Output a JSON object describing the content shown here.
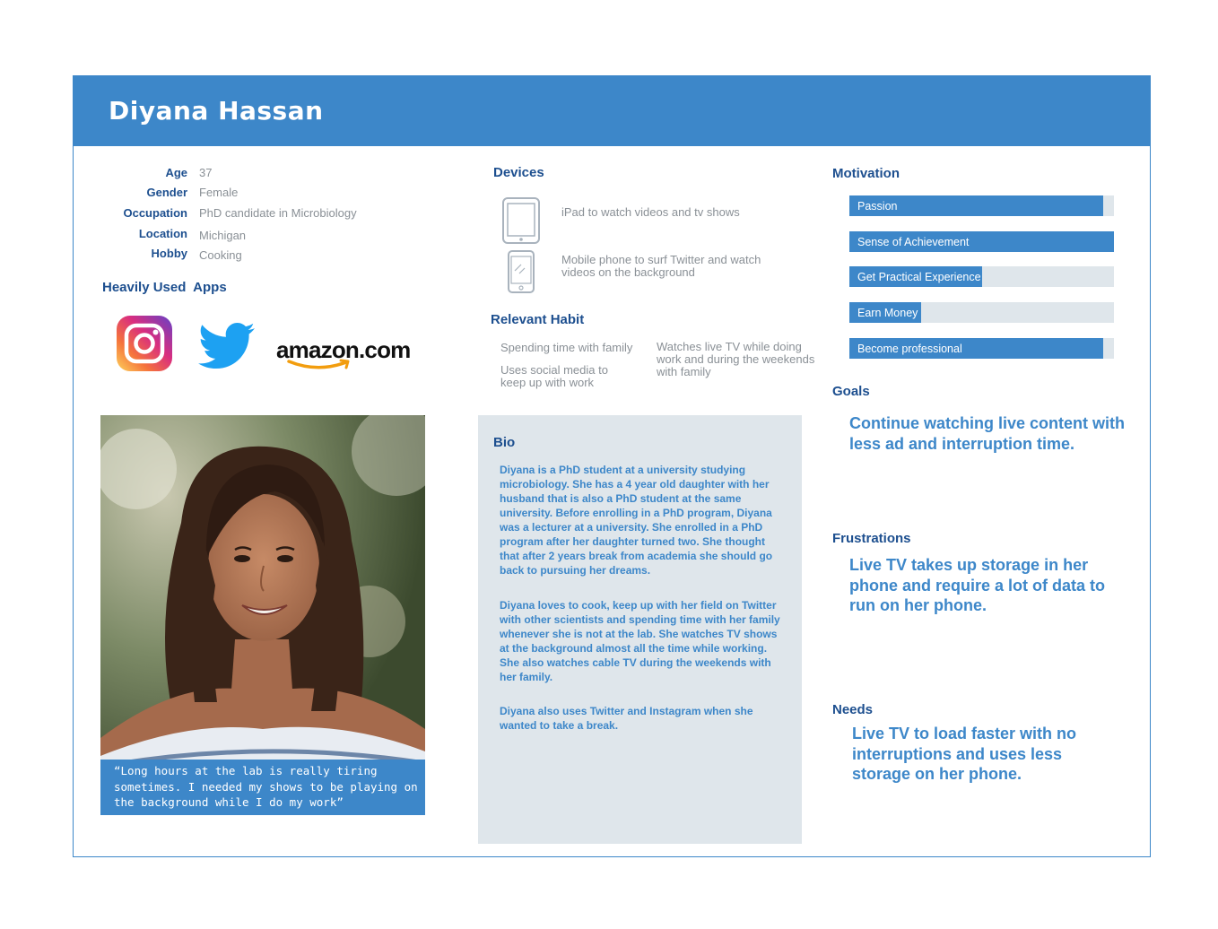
{
  "persona": {
    "name": "Diyana Hassan",
    "details": [
      {
        "label": "Age",
        "value": "37"
      },
      {
        "label": "Gender",
        "value": "Female"
      },
      {
        "label": "Occupation",
        "value": "PhD candidate in Microbiology"
      },
      {
        "label": "Location",
        "value": "Michigan"
      },
      {
        "label": "Hobby",
        "value": "Cooking"
      }
    ],
    "apps_title": "Heavily Used  Apps",
    "apps": [
      "instagram-logo",
      "twitter-logo",
      "amazon-logo"
    ],
    "amazon_text": "amazon.com",
    "quote": "“Long hours at the lab is really tiring sometimes. I needed my shows to be playing on the background while I do my work”"
  },
  "devices": {
    "title": "Devices",
    "items": [
      {
        "icon": "tablet-icon",
        "text": "iPad to watch videos and tv shows"
      },
      {
        "icon": "phone-icon",
        "text": "Mobile phone to surf Twitter and watch videos on the background"
      }
    ]
  },
  "habits": {
    "title": "Relevant Habit",
    "items": [
      "Spending time with family",
      "Uses social media to keep up with work",
      "Watches live TV while doing work and during the weekends with family"
    ]
  },
  "bio": {
    "title": "Bio",
    "paragraphs": [
      "Diyana is a PhD student at a university studying microbiology. She has a 4 year old daughter with her husband that is also a PhD student at the same university. Before enrolling in a PhD program, Diyana was a lecturer at a university. She enrolled in a PhD program after her daughter turned two. She thought that after 2 years break from academia she should go back to pursuing her dreams.",
      "Diyana loves to cook, keep up with her field on Twitter with other scientists and spending time with her family whenever she is not at the lab. She watches TV shows at the background almost all the time while working. She also watches cable TV during the weekends with her family.",
      "Diyana also uses Twitter and Instagram when she wanted to take a break."
    ]
  },
  "motivation": {
    "title": "Motivation",
    "items": [
      {
        "label": "Passion",
        "level": 0.96
      },
      {
        "label": "Sense of Achievement",
        "level": 1.0
      },
      {
        "label": "Get Practical Experience",
        "level": 0.5
      },
      {
        "label": "Earn Money",
        "level": 0.27
      },
      {
        "label": "Become professional",
        "level": 0.96
      }
    ]
  },
  "goals": {
    "title": "Goals",
    "text": "Continue watching live content with less ad and interruption time."
  },
  "frustrations": {
    "title": "Frustrations",
    "text": "Live TV takes up storage in her phone and require a lot of data to run on her phone."
  },
  "needs": {
    "title": "Needs",
    "text": "Live TV to load faster with no interruptions and uses less storage on her phone."
  },
  "colors": {
    "accent": "#3d87c9",
    "navy": "#1d4f8f",
    "muted": "#8a9096",
    "panel": "#dfe6eb"
  }
}
